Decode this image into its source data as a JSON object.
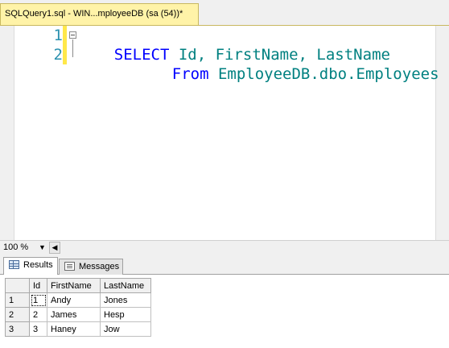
{
  "tab": {
    "title": "SQLQuery1.sql - WIN...mployeeDB (sa (54))*"
  },
  "editor": {
    "lines": [
      {
        "num": "1",
        "kw": "SELECT",
        "rest": " Id, FirstName, LastName"
      },
      {
        "num": "2",
        "kw": "From",
        "rest": " EmployeeDB.dbo.Employees"
      }
    ]
  },
  "zoom": {
    "value": "100 %"
  },
  "result_tabs": {
    "results": "Results",
    "messages": "Messages"
  },
  "grid": {
    "headers": [
      "Id",
      "FirstName",
      "LastName"
    ],
    "rows": [
      {
        "rownum": "1",
        "id": "1",
        "first": "Andy",
        "last": "Jones"
      },
      {
        "rownum": "2",
        "id": "2",
        "first": "James",
        "last": "Hesp"
      },
      {
        "rownum": "3",
        "id": "3",
        "first": "Haney",
        "last": "Jow"
      }
    ]
  }
}
